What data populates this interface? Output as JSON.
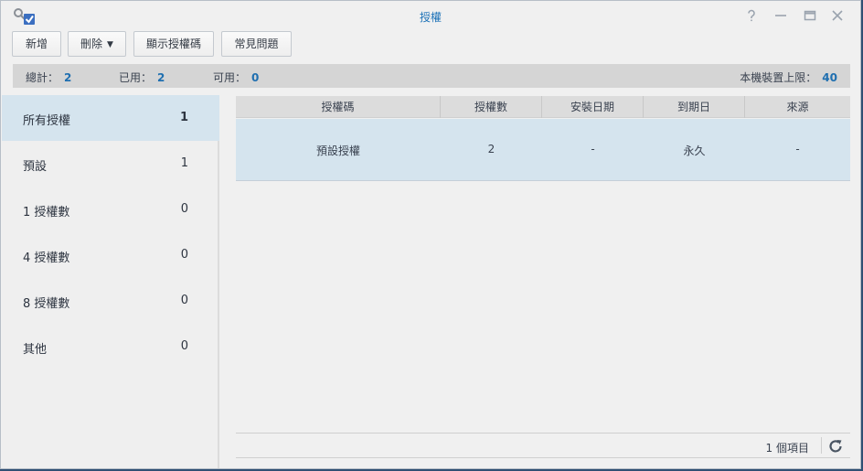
{
  "window": {
    "title": "授權",
    "controls": [
      "help-icon",
      "minimize-icon",
      "maximize-icon",
      "close-icon"
    ]
  },
  "toolbar": {
    "add_label": "新增",
    "delete_label": "刪除",
    "show_code_label": "顯示授權碼",
    "faq_label": "常見問題"
  },
  "summary": {
    "total_label": "總計：",
    "total_value": "2",
    "used_label": "已用：",
    "used_value": "2",
    "available_label": "可用：",
    "available_value": "0",
    "limit_label": "本機裝置上限：",
    "limit_value": "40"
  },
  "sidebar": {
    "items": [
      {
        "label": "所有授權",
        "count": "1",
        "selected": true
      },
      {
        "label": "預設",
        "count": "1"
      },
      {
        "label": "1 授權數",
        "count": "0"
      },
      {
        "label": "4 授權數",
        "count": "0"
      },
      {
        "label": "8 授權數",
        "count": "0"
      },
      {
        "label": "其他",
        "count": "0"
      }
    ]
  },
  "table": {
    "columns": [
      "授權碼",
      "授權數",
      "安裝日期",
      "到期日",
      "來源"
    ],
    "rows": [
      [
        "預設授權",
        "2",
        "-",
        "永久",
        "-"
      ]
    ]
  },
  "footer": {
    "item_count": "1 個項目"
  },
  "colors": {
    "accent": "#1f6fb0",
    "selected_bg": "#d5e4ee",
    "window_bg": "#f0f0f0"
  }
}
